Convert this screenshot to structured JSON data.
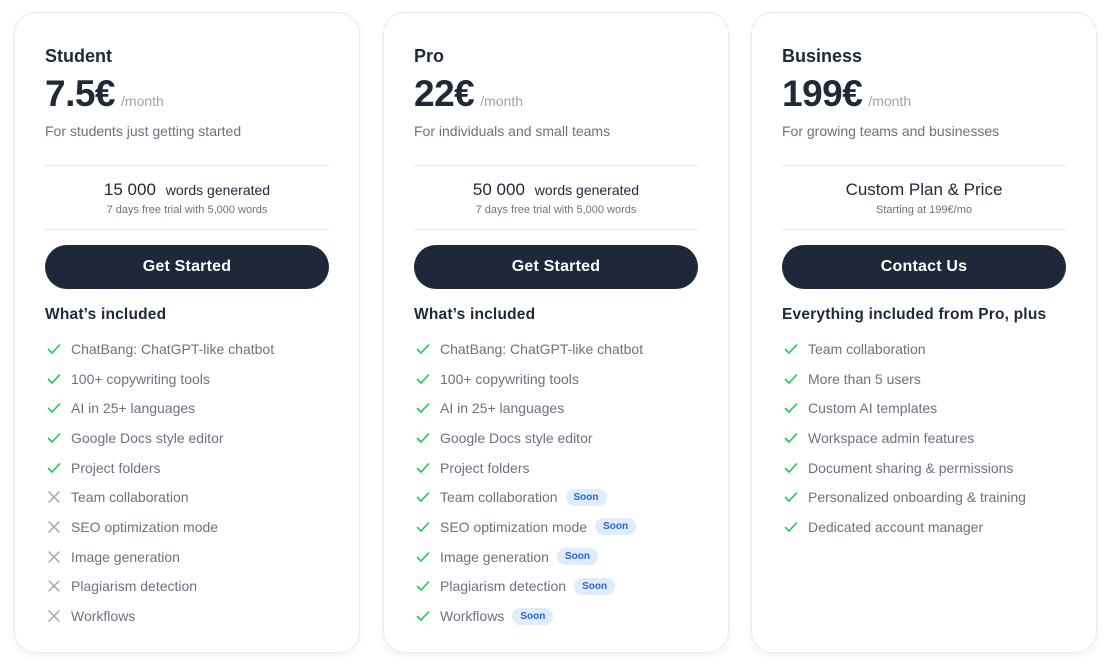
{
  "colors": {
    "button_bg": "#1e2838",
    "check": "#22c55e",
    "cross": "#9ca3af",
    "badge_text": "#2563eb",
    "badge_bg": "#e0ecfb"
  },
  "plans": [
    {
      "name": "Student",
      "price": "7.5€",
      "period": "/month",
      "tagline": "For students just getting started",
      "quota_number": "15 000",
      "quota_label": "words generated",
      "quota_sub": "7 days free trial with 5,000 words",
      "cta": "Get Started",
      "included_title": "What’s included",
      "features": [
        {
          "label": "ChatBang: ChatGPT-like chatbot",
          "icon": "check-icon",
          "badge": null
        },
        {
          "label": "100+ copywriting tools",
          "icon": "check-icon",
          "badge": null
        },
        {
          "label": "AI in 25+ languages",
          "icon": "check-icon",
          "badge": null
        },
        {
          "label": "Google Docs style editor",
          "icon": "check-icon",
          "badge": null
        },
        {
          "label": "Project folders",
          "icon": "check-icon",
          "badge": null
        },
        {
          "label": "Team collaboration",
          "icon": "x-icon",
          "badge": null
        },
        {
          "label": "SEO optimization mode",
          "icon": "x-icon",
          "badge": null
        },
        {
          "label": "Image generation",
          "icon": "x-icon",
          "badge": null
        },
        {
          "label": "Plagiarism detection",
          "icon": "x-icon",
          "badge": null
        },
        {
          "label": "Workflows",
          "icon": "x-icon",
          "badge": null
        }
      ]
    },
    {
      "name": "Pro",
      "price": "22€",
      "period": "/month",
      "tagline": "For individuals and small teams",
      "quota_number": "50 000",
      "quota_label": "words generated",
      "quota_sub": "7 days free trial with 5,000 words",
      "cta": "Get Started",
      "included_title": "What’s included",
      "features": [
        {
          "label": "ChatBang: ChatGPT-like chatbot",
          "icon": "check-icon",
          "badge": null
        },
        {
          "label": "100+ copywriting tools",
          "icon": "check-icon",
          "badge": null
        },
        {
          "label": "AI in 25+ languages",
          "icon": "check-icon",
          "badge": null
        },
        {
          "label": "Google Docs style editor",
          "icon": "check-icon",
          "badge": null
        },
        {
          "label": "Project folders",
          "icon": "check-icon",
          "badge": null
        },
        {
          "label": "Team collaboration",
          "icon": "check-icon",
          "badge": "Soon"
        },
        {
          "label": "SEO optimization mode",
          "icon": "check-icon",
          "badge": "Soon"
        },
        {
          "label": "Image generation",
          "icon": "check-icon",
          "badge": "Soon"
        },
        {
          "label": "Plagiarism detection",
          "icon": "check-icon",
          "badge": "Soon"
        },
        {
          "label": "Workflows",
          "icon": "check-icon",
          "badge": "Soon"
        }
      ]
    },
    {
      "name": "Business",
      "price": "199€",
      "period": "/month",
      "tagline": "For growing teams and businesses",
      "quota_custom": "Custom Plan & Price",
      "quota_sub": "Starting at 199€/mo",
      "cta": "Contact Us",
      "included_title": "Everything included from Pro, plus",
      "features": [
        {
          "label": "Team collaboration",
          "icon": "check-icon",
          "badge": null
        },
        {
          "label": "More than 5 users",
          "icon": "check-icon",
          "badge": null
        },
        {
          "label": "Custom AI templates",
          "icon": "check-icon",
          "badge": null
        },
        {
          "label": "Workspace admin features",
          "icon": "check-icon",
          "badge": null
        },
        {
          "label": "Document sharing & permissions",
          "icon": "check-icon",
          "badge": null
        },
        {
          "label": "Personalized onboarding & training",
          "icon": "check-icon",
          "badge": null
        },
        {
          "label": "Dedicated account manager",
          "icon": "check-icon",
          "badge": null
        }
      ]
    }
  ]
}
